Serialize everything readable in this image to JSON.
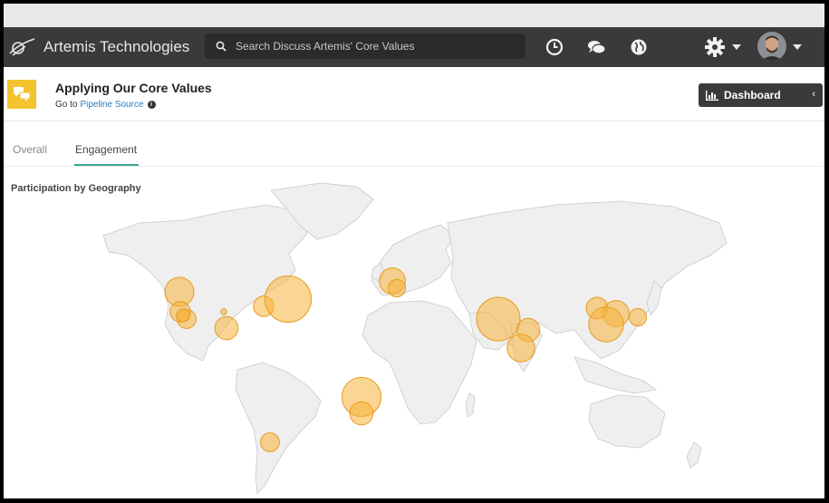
{
  "navbar": {
    "brand": "Artemis Technologies",
    "search_placeholder": "Search Discuss Artemis' Core Values",
    "icons": [
      "history-icon",
      "chat-icon",
      "globe-icon",
      "gear-icon"
    ]
  },
  "header": {
    "title": "Applying Our Core Values",
    "goto_prefix": "Go to",
    "goto_link": "Pipeline Source",
    "dashboard_label": "Dashboard",
    "dashboard_chevron": "‹"
  },
  "tabs": [
    {
      "label": "Overall",
      "active": false
    },
    {
      "label": "Engagement",
      "active": true
    }
  ],
  "section_title": "Participation by Geography",
  "colors": {
    "accent": "#3aa592",
    "bubble_fill": "#f6b23a",
    "bubble_stroke": "#e89b1f",
    "land": "#efefef",
    "border": "#c9c9c9",
    "icon_yellow": "#f2c32e"
  },
  "bubbles": [
    {
      "region": "vancouver",
      "size": 1.0
    },
    {
      "region": "san-francisco",
      "size": 0.7
    },
    {
      "region": "los-angeles",
      "size": 0.65
    },
    {
      "region": "san-diego",
      "size": 0.45
    },
    {
      "region": "denver",
      "size": 0.2
    },
    {
      "region": "houston",
      "size": 0.8
    },
    {
      "region": "toronto",
      "size": 0.7
    },
    {
      "region": "boston",
      "size": 1.6
    },
    {
      "region": "london",
      "size": 0.9
    },
    {
      "region": "paris",
      "size": 0.6
    },
    {
      "region": "dubai",
      "size": 1.5
    },
    {
      "region": "delhi",
      "size": 0.8
    },
    {
      "region": "mumbai",
      "size": 0.95
    },
    {
      "region": "beijing",
      "size": 0.75
    },
    {
      "region": "shanghai",
      "size": 0.9
    },
    {
      "region": "hong-kong",
      "size": 1.2
    },
    {
      "region": "tokyo",
      "size": 0.6
    },
    {
      "region": "south-atlantic",
      "size": 1.35
    },
    {
      "region": "south-atlantic-2",
      "size": 0.8
    },
    {
      "region": "buenos-aires",
      "size": 0.65
    }
  ]
}
